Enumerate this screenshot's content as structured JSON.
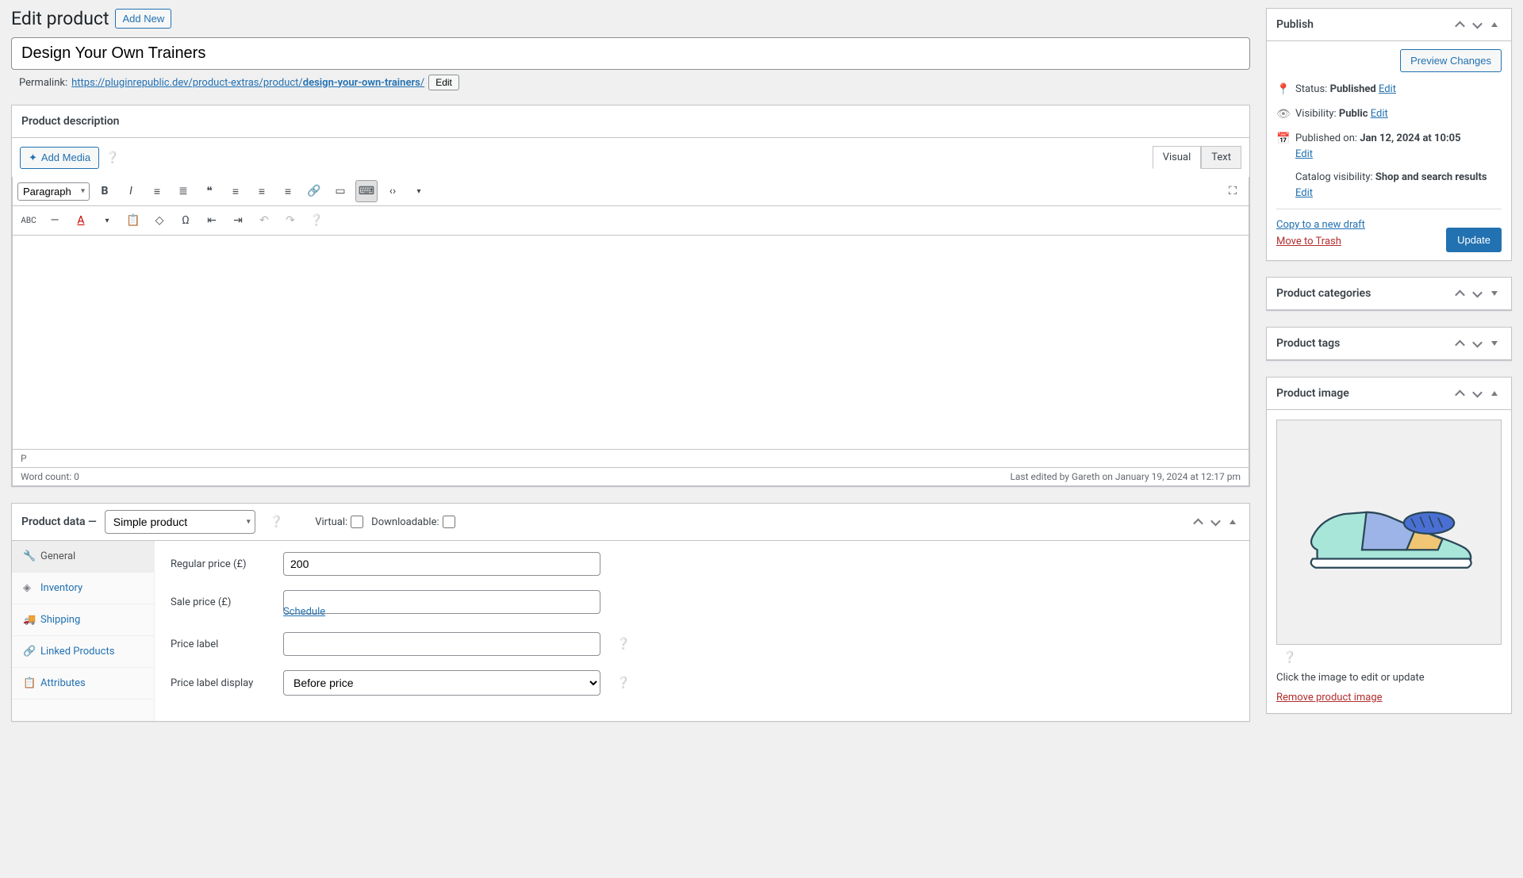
{
  "header": {
    "title": "Edit product",
    "add_new": "Add New"
  },
  "product_title": "Design Your Own Trainers",
  "permalink": {
    "label": "Permalink:",
    "base": "https://pluginrepublic.dev/product-extras/product/",
    "slug": "design-your-own-trainers",
    "edit": "Edit"
  },
  "desc": {
    "heading": "Product description",
    "add_media": "Add Media",
    "tabs": {
      "visual": "Visual",
      "text": "Text"
    },
    "format": "Paragraph",
    "path": "P",
    "word_count": "Word count: 0",
    "last_edited": "Last edited by Gareth on January 19, 2024 at 12:17 pm"
  },
  "product_data": {
    "heading": "Product data —",
    "type": "Simple product",
    "virtual_label": "Virtual:",
    "downloadable_label": "Downloadable:",
    "tabs": [
      "General",
      "Inventory",
      "Shipping",
      "Linked Products",
      "Attributes"
    ],
    "tab_icons": [
      "🔧",
      "◈",
      "🚚",
      "🔗",
      "📋"
    ],
    "fields": {
      "regular_price_label": "Regular price (£)",
      "regular_price": "200",
      "sale_price_label": "Sale price (£)",
      "sale_price": "",
      "schedule": "Schedule",
      "price_label_label": "Price label",
      "price_label": "",
      "price_label_display_label": "Price label display",
      "price_label_display": "Before price"
    }
  },
  "publish": {
    "heading": "Publish",
    "preview": "Preview Changes",
    "status_label": "Status:",
    "status": "Published",
    "visibility_label": "Visibility:",
    "visibility": "Public",
    "published_label": "Published on:",
    "published": "Jan 12, 2024 at 10:05",
    "catalog_label": "Catalog visibility:",
    "catalog": "Shop and search results",
    "edit": "Edit",
    "copy": "Copy to a new draft",
    "trash": "Move to Trash",
    "update": "Update"
  },
  "categories": {
    "heading": "Product categories"
  },
  "tags": {
    "heading": "Product tags"
  },
  "image": {
    "heading": "Product image",
    "hint": "Click the image to edit or update",
    "remove": "Remove product image"
  }
}
